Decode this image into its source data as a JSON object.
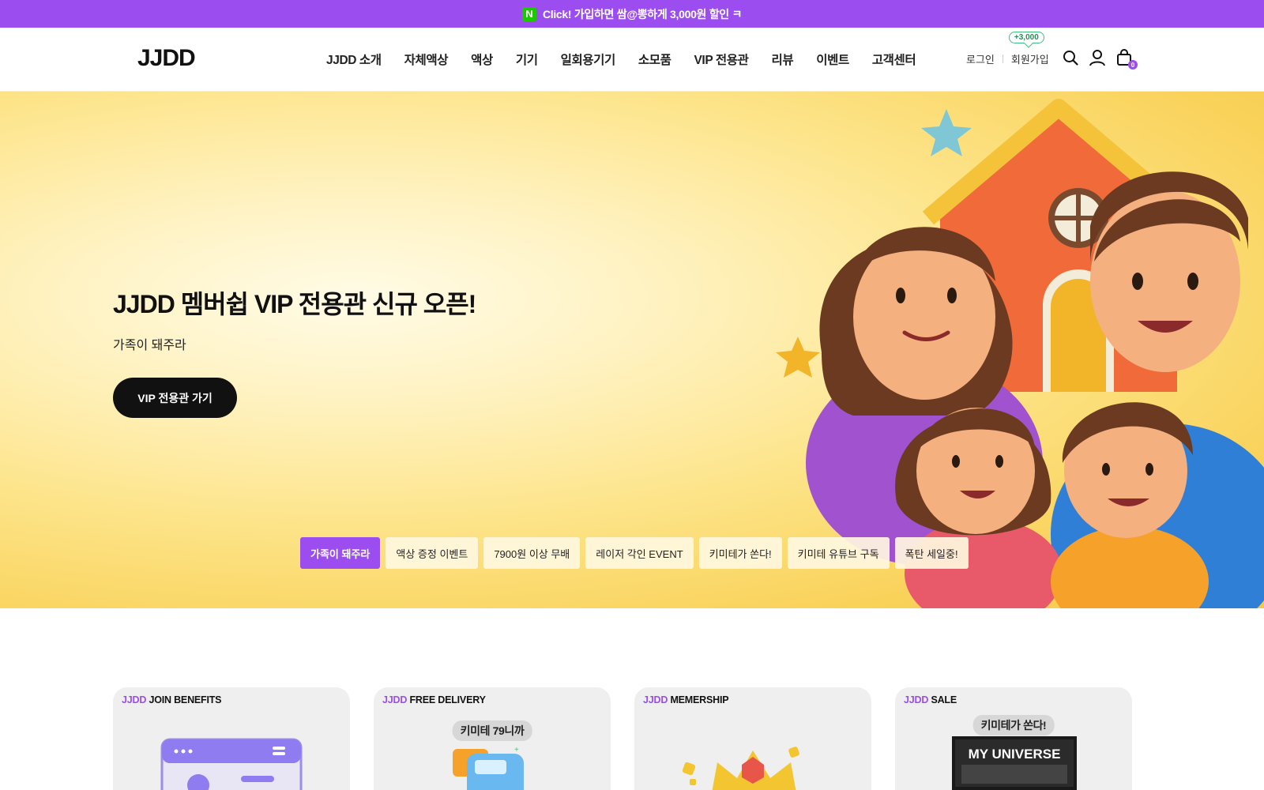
{
  "promo_bar": {
    "naver_badge": "N",
    "text": "Click! 가입하면 쌈@뽕하게 3,000원 할인 ㅋ"
  },
  "header": {
    "logo": "JJDD",
    "nav": [
      "JJDD 소개",
      "자체액상",
      "액상",
      "기기",
      "일회용기기",
      "소모품",
      "VIP 전용관",
      "리뷰",
      "이벤트",
      "고객센터"
    ],
    "login": "로그인",
    "join": "회원가입",
    "join_bonus": "+3,000",
    "cart_count": "0",
    "icons": [
      "search-icon",
      "user-icon",
      "cart-icon"
    ]
  },
  "hero": {
    "title": "JJDD 멤버쉽 VIP 전용관 신규 오픈!",
    "subtitle": "가족이 돼주라",
    "button": "VIP 전용관 가기",
    "tags": [
      "가족이 돼주라",
      "액상 증정 이벤트",
      "7900원 이상 무배",
      "레이저 각인 EVENT",
      "키미테가 쏜다!",
      "키미테 유튜브 구독",
      "폭탄 세일중!"
    ],
    "active_tag": 0
  },
  "cards": [
    {
      "brand": "JJDD",
      "label": "JOIN BENEFITS",
      "pill": ""
    },
    {
      "brand": "JJDD",
      "label": "FREE DELIVERY",
      "pill": "키미테 79니까"
    },
    {
      "brand": "JJDD",
      "label": "MEMERSHIP",
      "pill": ""
    },
    {
      "brand": "JJDD",
      "label": "SALE",
      "pill": "키미테가 쏜다!",
      "art_text": "MY UNIVERSE"
    }
  ],
  "colors": {
    "accent": "#9b4df0",
    "naver": "#1ec800",
    "hero_yellow": "#fde489"
  }
}
